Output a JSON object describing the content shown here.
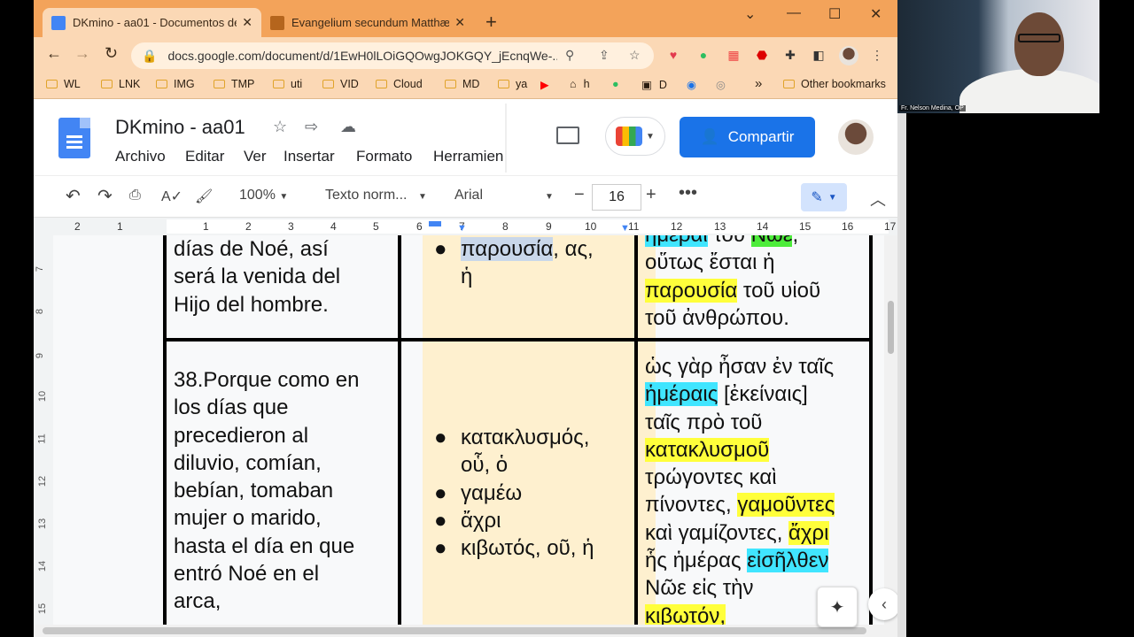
{
  "browser": {
    "tabs": [
      {
        "title": "DKmino - aa01 - Documentos de",
        "active": true,
        "favicon": "docs-icon"
      },
      {
        "title": "Evangelium secundum Matthæum",
        "active": false,
        "favicon": "book-icon"
      }
    ],
    "url": "docs.google.com/document/d/1EwH0lLOiGQOwgJOKGQY_jEcnqWe-...",
    "bookmarks": [
      "WL",
      "LNK",
      "IMG",
      "TMP",
      "uti",
      "VID",
      "Cloud",
      "MD",
      "ya",
      "h",
      "D",
      "»",
      "Other bookmarks"
    ],
    "accent": "#f3a35a"
  },
  "docs": {
    "title": "DKmino - aa01",
    "menus": [
      "Archivo",
      "Editar",
      "Ver",
      "Insertar",
      "Formato",
      "Herramien"
    ],
    "share_label": "Compartir",
    "zoom": "100%",
    "style": "Texto norm...",
    "font": "Arial",
    "font_size": "16",
    "ruler_numbers": [
      "2",
      "1",
      "1",
      "2",
      "3",
      "4",
      "5",
      "6",
      "7",
      "8",
      "9",
      "10",
      "11",
      "12",
      "13",
      "14",
      "15",
      "16",
      "17"
    ],
    "vruler_numbers": [
      "7",
      "8",
      "9",
      "10",
      "11",
      "12",
      "13",
      "14",
      "15"
    ]
  },
  "table": {
    "row1": {
      "spanish": [
        "días de Noé, así",
        "será la venida del",
        "Hijo del hombre."
      ],
      "vocab": [
        [
          "παρουσία",
          ", ας,"
        ],
        [
          "ἡ"
        ]
      ],
      "greek": [
        "ἡμέραι",
        "τοῦ",
        "Νῶε",
        ",",
        "οὕτως ἔσται ἡ",
        "παρουσία",
        "τοῦ υἱοῦ",
        "τοῦ ἀνθρώπου."
      ]
    },
    "row2": {
      "spanish": [
        "38.Porque como en",
        "los días que",
        "precedieron al",
        "diluvio, comían,",
        "bebían, tomaban",
        "mujer o marido,",
        "hasta el día en que",
        "entró Noé en el",
        "arca,"
      ],
      "vocab": [
        "κατακλυσμός,",
        "οὗ, ὁ",
        "γαμέω",
        "ἄχρι",
        "κιβωτός, οῦ, ἡ"
      ],
      "greek": {
        "l1": "ὡς γὰρ ἦσαν ἐν ταῖς",
        "l2a": "ἡμέραις",
        "l2b": " [ἐκείναις]",
        "l3": "ταῖς πρὸ τοῦ",
        "l4": "κατακλυσμοῦ",
        "l5": "τρώγοντες καὶ",
        "l6a": "πίνοντες, ",
        "l6b": "γαμοῦντες",
        "l7a": "καὶ γαμίζοντες, ",
        "l7b": "ἄχρι",
        "l8a": "ἧς ἡμέρας ",
        "l8b": "εἰσῆλθεν",
        "l9": "Νῶε εἰς τὴν",
        "l10": "κιβωτόν,"
      }
    }
  },
  "webcam": {
    "label": "Fr. Nelson Medina, OP"
  },
  "colors": {
    "highlight_yellow": "#ffff3b",
    "highlight_cyan": "#40e5ff",
    "highlight_green": "#4dec3a",
    "vocab_column": "#fef0cf",
    "share": "#1a73e8"
  }
}
